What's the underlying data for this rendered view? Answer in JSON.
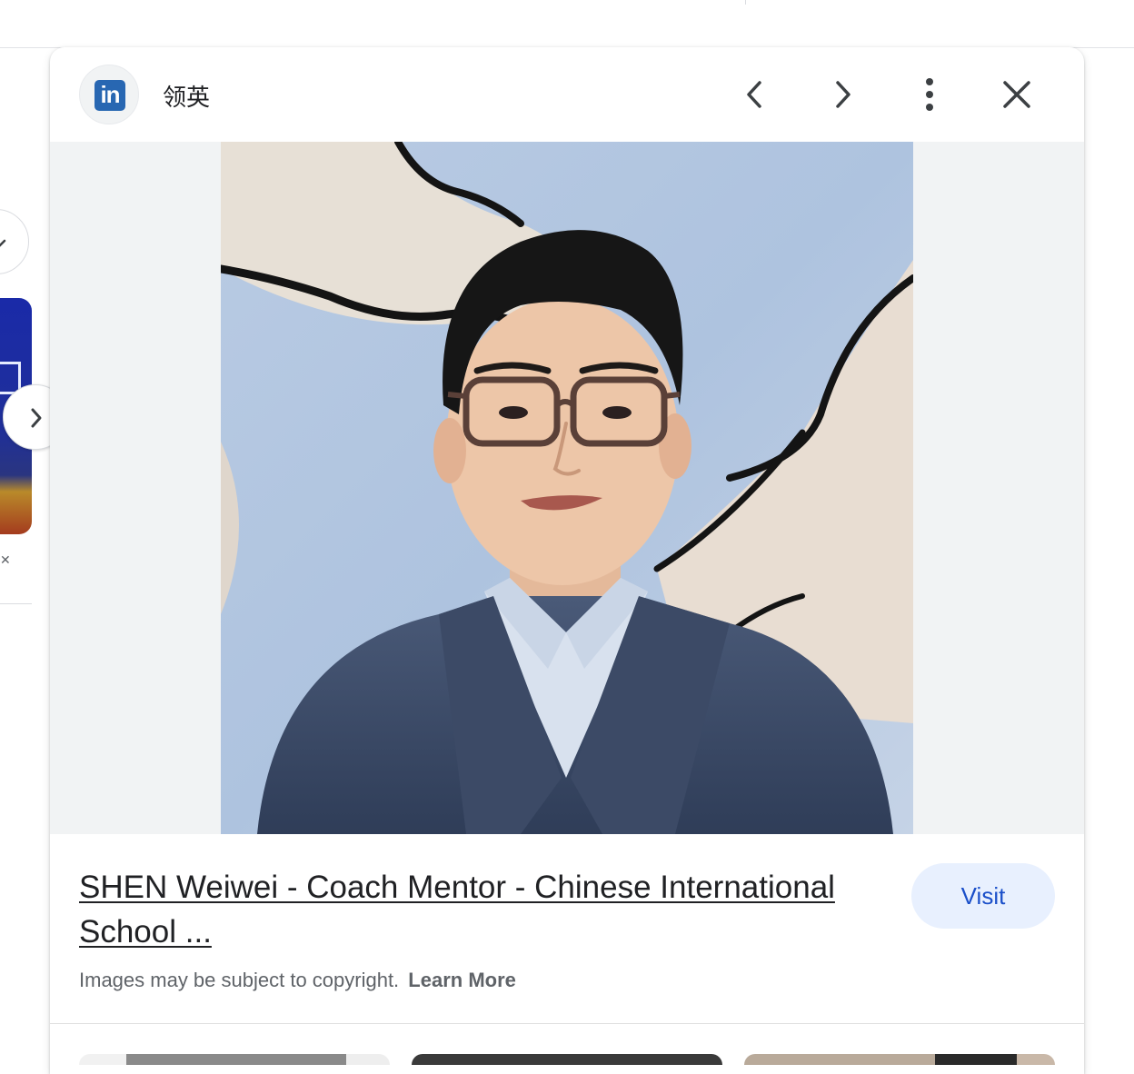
{
  "panel": {
    "source_name": "领英",
    "source_logo_text": "in",
    "title": "SHEN Weiwei - Coach Mentor - Chinese International School ...",
    "visit_label": "Visit",
    "copyright_text": "Images may be subject to copyright.",
    "learn_more_label": "Learn More"
  },
  "colors": {
    "linkedin_blue": "#2867b2",
    "visit_bg": "#e8f0fe",
    "visit_text": "#1a4fc9"
  },
  "icons": [
    "chevron-left-icon",
    "chevron-right-icon",
    "more-vert-icon",
    "close-icon"
  ]
}
